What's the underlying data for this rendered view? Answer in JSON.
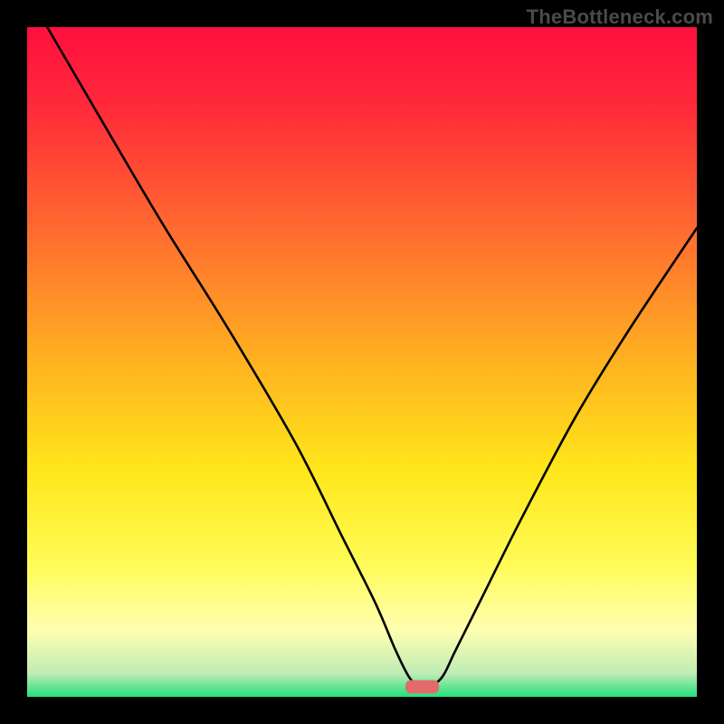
{
  "watermark": "TheBottleneck.com",
  "chart_data": {
    "type": "line",
    "title": "",
    "xlabel": "",
    "ylabel": "",
    "xlim": [
      0,
      100
    ],
    "ylim": [
      0,
      100
    ],
    "grid": false,
    "legend": false,
    "series": [
      {
        "name": "bottleneck-curve",
        "x": [
          3,
          10,
          20,
          30,
          40,
          47,
          52,
          55,
          57,
          58.5,
          60,
          62,
          64,
          68,
          74,
          82,
          90,
          100
        ],
        "y": [
          100,
          88,
          71,
          55,
          38,
          24,
          14,
          7,
          3,
          1.5,
          1.5,
          3,
          7,
          15,
          27,
          42,
          55,
          70
        ]
      }
    ],
    "background_gradient": {
      "stops": [
        {
          "pos": 0.0,
          "color": "#ff0f3f"
        },
        {
          "pos": 0.12,
          "color": "#ff2a3a"
        },
        {
          "pos": 0.3,
          "color": "#ff6a30"
        },
        {
          "pos": 0.5,
          "color": "#ffb221"
        },
        {
          "pos": 0.66,
          "color": "#ffe61a"
        },
        {
          "pos": 0.8,
          "color": "#fffb55"
        },
        {
          "pos": 0.9,
          "color": "#ffffb0"
        },
        {
          "pos": 0.965,
          "color": "#bfecb5"
        },
        {
          "pos": 1.0,
          "color": "#22e07a"
        }
      ]
    },
    "marker": {
      "x": 59,
      "y": 1.5,
      "width": 5,
      "height": 2,
      "color": "#e26a6a",
      "shape": "rounded-rect"
    }
  }
}
